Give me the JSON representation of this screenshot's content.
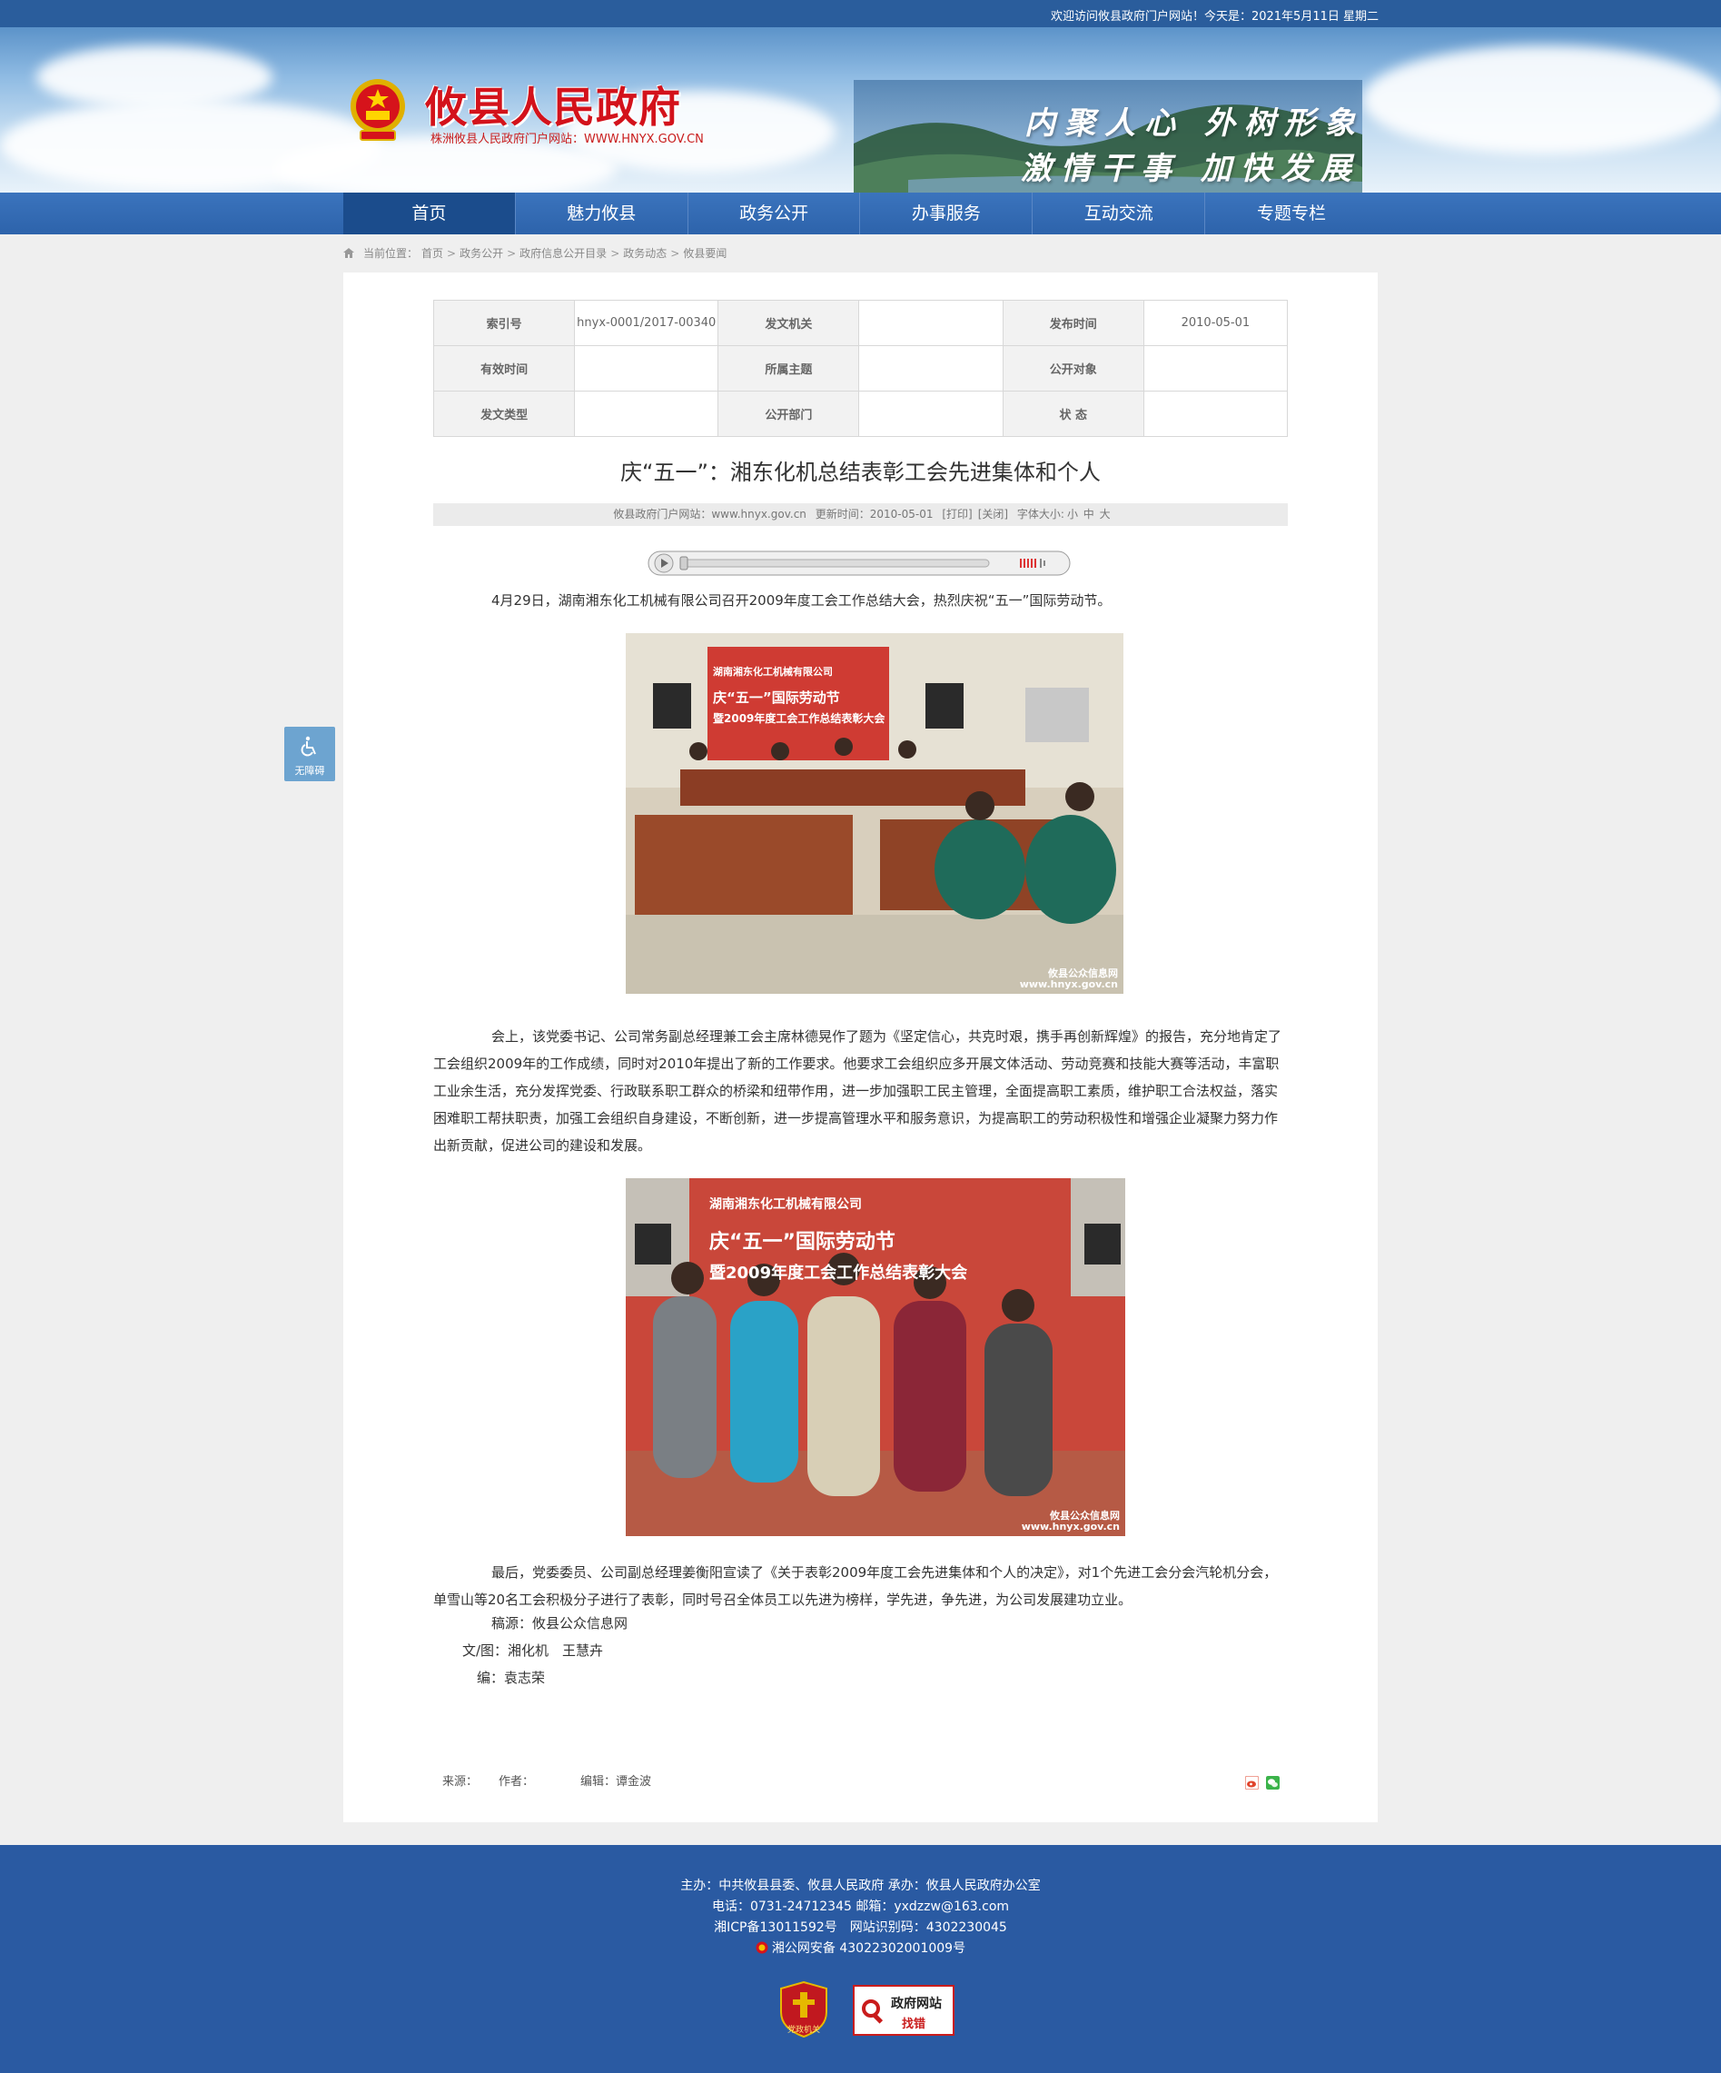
{
  "topbar": {
    "welcome": "欢迎访问攸县政府门户网站！今天是：2021年5月11日 星期二"
  },
  "header": {
    "site_title": "攸县人民政府",
    "site_subtitle": "株洲攸县人民政府门户网站：WWW.HNYX.GOV.CN",
    "slogan_line1": "内聚人心 外树形象",
    "slogan_line2": "激情干事 加快发展"
  },
  "nav": {
    "items": [
      "首页",
      "魅力攸县",
      "政务公开",
      "办事服务",
      "互动交流",
      "专题专栏"
    ],
    "active": "首页"
  },
  "breadcrumb": {
    "label": "当前位置：",
    "items": [
      "首页",
      "政务公开",
      "政府信息公开目录",
      "政务动态",
      "攸县要闻"
    ],
    "separator": ">"
  },
  "meta_table": {
    "row1": {
      "k1": "索引号",
      "v1": "hnyx-0001/2017-00340",
      "k2": "发文机关",
      "v2": "",
      "k3": "发布时间",
      "v3": "2010-05-01"
    },
    "row2": {
      "k1": "有效时间",
      "v1": "",
      "k2": "所属主题",
      "v2": "",
      "k3": "公开对象",
      "v3": ""
    },
    "row3": {
      "k1": "发文类型",
      "v1": "",
      "k2": "公开部门",
      "v2": "",
      "k3": "状 态",
      "v3": ""
    }
  },
  "article": {
    "title": "庆“五一”：湘东化机总结表彰工会先进集体和个人",
    "info": {
      "source": "攸县政府门户网站：www.hnyx.gov.cn",
      "updated": "更新时间：2010-05-01",
      "print": "[打印]",
      "close": "[关闭]",
      "font_label": "字体大小:",
      "font_small": "小",
      "font_medium": "中",
      "font_large": "大"
    },
    "p1": "4月29日，湖南湘东化工机械有限公司召开2009年度工会工作总结大会，热烈庆祝“五一”国际劳动节。",
    "p2": "会上，该党委书记、公司常务副总经理兼工会主席林德晃作了题为《坚定信心，共克时艰，携手再创新辉煌》的报告，充分地肯定了工会组织2009年的工作成绩，同时对2010年提出了新的工作要求。他要求工会组织应多开展文体活动、劳动竞赛和技能大赛等活动，丰富职工业余生活，充分发挥党委、行政联系职工群众的桥梁和纽带作用，进一步加强职工民主管理，全面提高职工素质，维护职工合法权益，落实困难职工帮扶职责，加强工会组织自身建设，不断创新，进一步提高管理水平和服务意识，为提高职工的劳动积极性和增强企业凝聚力努力作出新贡献，促进公司的建设和发展。",
    "p3": "最后，党委委员、公司副总经理姜衡阳宣读了《关于表彰2009年度工会先进集体和个人的决定》，对1个先进工会分会汽轮机分会，单雪山等20名工会积极分子进行了表彰，同时号召全体员工以先进为榜样，学先进，争先进，为公司发展建功立业。",
    "sig1": "稿源：攸县公众信息网",
    "sig2": "文/图：湘化机　王慧卉",
    "sig3": "编：袁志荣",
    "photo1_banner_line1": "湖南湘东化工机械有限公司",
    "photo1_banner_line2": "庆“五一”国际劳动节",
    "photo1_banner_line3": "暨2009年度工会工作总结表彰大会",
    "photo2_banner_line1": "湖南湘东化工机械有限公司",
    "photo2_banner_line2": "庆“五一”国际劳动节",
    "photo2_banner_line3": "暨2009年度工会工作总结表彰大会",
    "watermark_line1": "攸县公众信息网",
    "watermark_line2": "www.hnyx.gov.cn",
    "source_label": "来源：",
    "author_label": "作者：",
    "editor": "编辑：谭金波"
  },
  "accessibility": {
    "label": "无障碍"
  },
  "footer": {
    "line1": "主办：中共攸县县委、攸县人民政府 承办：攸县人民政府办公室",
    "line2": "电话：0731-24712345 邮箱：yxdzzw@163.com",
    "line3": "湘ICP备13011592号　网站识别码：4302230045",
    "line4": "湘公网安备 43022302001009号",
    "badge1_text": "党政机关",
    "badge2_line1": "政府网站",
    "badge2_line2": "找错"
  },
  "colors": {
    "brand_blue": "#2a5d9c",
    "title_red": "#d3121b"
  }
}
